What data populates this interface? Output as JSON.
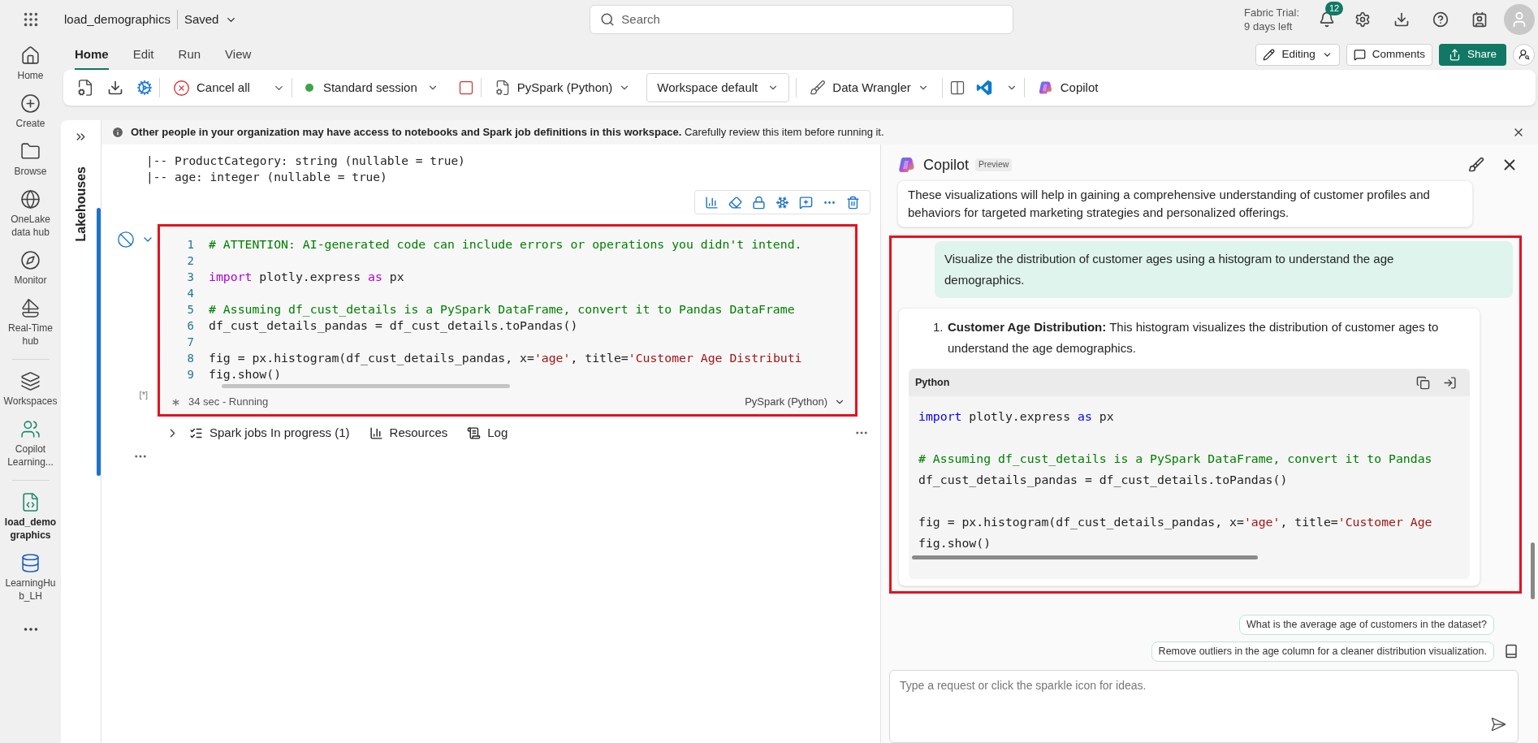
{
  "top_bar": {
    "file_name": "load_demographics",
    "save_status": "Saved",
    "search_placeholder": "Search",
    "trial_lines": [
      "Fabric Trial:",
      "9 days left"
    ],
    "notification_count": "12"
  },
  "rail": [
    {
      "lines": [
        "Home"
      ],
      "selected": false,
      "divider_after": false
    },
    {
      "lines": [
        "Create"
      ],
      "selected": false,
      "divider_after": false
    },
    {
      "lines": [
        "Browse"
      ],
      "selected": false,
      "divider_after": false
    },
    {
      "lines": [
        "OneLake",
        "data hub"
      ],
      "selected": false,
      "divider_after": false
    },
    {
      "lines": [
        "Monitor"
      ],
      "selected": false,
      "divider_after": false
    },
    {
      "lines": [
        "Real-Time",
        "hub"
      ],
      "selected": false,
      "divider_after": true
    },
    {
      "lines": [
        "Workspaces"
      ],
      "selected": false,
      "divider_after": false
    },
    {
      "lines": [
        "Copilot",
        "Learning..."
      ],
      "selected": false,
      "divider_after": true
    },
    {
      "lines": [
        "load_demo",
        "graphics"
      ],
      "selected": true,
      "divider_after": false
    },
    {
      "lines": [
        "LearningHu",
        "b_LH"
      ],
      "selected": false,
      "divider_after": false
    }
  ],
  "ribbon_tabs": [
    {
      "label": "Home",
      "selected": true
    },
    {
      "label": "Edit",
      "selected": false
    },
    {
      "label": "Run",
      "selected": false
    },
    {
      "label": "View",
      "selected": false
    }
  ],
  "header_buttons": {
    "editing": "Editing",
    "comments": "Comments",
    "share": "Share"
  },
  "toolbar": {
    "cancel_all": "Cancel all",
    "session": {
      "label": "Standard session",
      "color": "#3ea34a"
    },
    "language": "PySpark (Python)",
    "environment": "Workspace default",
    "data_wrangler": "Data Wrangler",
    "copilot": "Copilot"
  },
  "banner": "**Other people in your organization may have access to notebooks and Spark job definitions in this workspace.** Carefully review this item before running it.",
  "side_panel": {
    "label": "Lakehouses"
  },
  "output_lines": [
    "|-- ProductCategory: string (nullable = true)",
    "|-- age: integer (nullable = true)"
  ],
  "cell": {
    "highlighted": true,
    "execution_count": "[*]",
    "status": "34 sec - Running",
    "language": "PySpark (Python)",
    "lines": [
      {
        "blank_before": false,
        "tokens": [
          {
            "kind": "comment",
            "text": "# ATTENTION: AI-generated code can include errors or operations you didn't intend."
          }
        ]
      },
      {
        "blank_before": true,
        "tokens": [
          {
            "kind": "keyword",
            "text": "import"
          },
          {
            "kind": "plain",
            "text": " plotly.express "
          },
          {
            "kind": "keyword",
            "text": "as"
          },
          {
            "kind": "plain",
            "text": " px"
          }
        ]
      },
      {
        "blank_before": true,
        "tokens": [
          {
            "kind": "comment",
            "text": "# Assuming df_cust_details is a PySpark DataFrame, convert it to Pandas DataFrame"
          }
        ]
      },
      {
        "blank_before": false,
        "tokens": [
          {
            "kind": "plain",
            "text": "df_cust_details_pandas = df_cust_details.toPandas()"
          }
        ]
      },
      {
        "blank_before": true,
        "tokens": [
          {
            "kind": "plain",
            "text": "fig = px.histogram(df_cust_details_pandas, x="
          },
          {
            "kind": "string",
            "text": "'age'"
          },
          {
            "kind": "plain",
            "text": ", title="
          },
          {
            "kind": "string",
            "text": "'Customer Age Distributi"
          }
        ]
      },
      {
        "blank_before": false,
        "tokens": [
          {
            "kind": "plain",
            "text": "fig.show()"
          }
        ]
      }
    ],
    "line_numbers": [
      "1",
      "2",
      "3",
      "4",
      "5",
      "6",
      "7",
      "8",
      "9"
    ]
  },
  "cell_footer": {
    "spark_jobs": "Spark jobs In progress (1)",
    "resources": "Resources",
    "log": "Log"
  },
  "copilot": {
    "title": "Copilot",
    "badge": "Preview",
    "previous_reply": "These visualizations will help in gaining a comprehensive understanding of customer profiles and behaviors for targeted marketing strategies and personalized offerings.",
    "highlighted": true,
    "user_message": "Visualize the distribution of customer ages using a histogram to understand the age demographics.",
    "reply_items": [
      {
        "number": "1.",
        "text": "**Customer Age Distribution:** This histogram visualizes the distribution of customer ages to understand the age demographics."
      }
    ],
    "code_block": {
      "language": "Python",
      "lines": [
        {
          "blank_before": false,
          "tokens": [
            {
              "kind": "keyword",
              "text": "import"
            },
            {
              "kind": "plain",
              "text": " plotly.express "
            },
            {
              "kind": "keyword",
              "text": "as"
            },
            {
              "kind": "plain",
              "text": " px"
            }
          ]
        },
        {
          "blank_before": true,
          "tokens": [
            {
              "kind": "comment",
              "text": "# Assuming df_cust_details is a PySpark DataFrame, convert it to Pandas"
            }
          ]
        },
        {
          "blank_before": false,
          "tokens": [
            {
              "kind": "plain",
              "text": "df_cust_details_pandas = df_cust_details.toPandas()"
            }
          ]
        },
        {
          "blank_before": true,
          "tokens": [
            {
              "kind": "plain",
              "text": "fig = px.histogram(df_cust_details_pandas, x="
            },
            {
              "kind": "string",
              "text": "'age'"
            },
            {
              "kind": "plain",
              "text": ", title="
            },
            {
              "kind": "string",
              "text": "'Customer Age"
            }
          ]
        },
        {
          "blank_before": false,
          "tokens": [
            {
              "kind": "plain",
              "text": "fig.show()"
            }
          ]
        }
      ]
    },
    "suggestions": [
      "What is the average age of customers in the dataset?",
      "Remove outliers in the age column for a cleaner distribution visualization."
    ],
    "input_placeholder": "Type a request or click the sparkle icon for ideas."
  }
}
